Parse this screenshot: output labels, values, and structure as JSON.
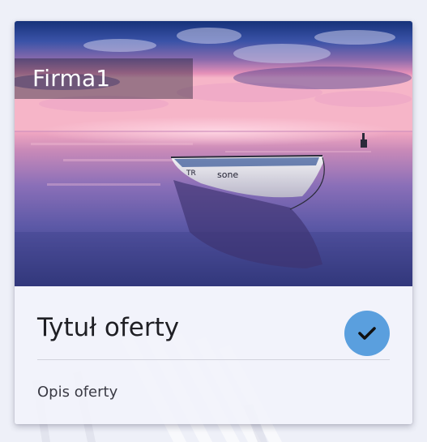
{
  "card": {
    "company_name": "Firma1",
    "title": "Tytuł oferty",
    "description": "Opis oferty",
    "image_icon": "boat-lake-sunset-photo",
    "select_icon": "check-icon"
  },
  "colors": {
    "page_background": "#eef0f8",
    "card_background": "#f2f3fb",
    "select_button": "#5a9fde",
    "check_mark": "#111111",
    "title_text": "#1f1f24",
    "description_text": "#3a3a44"
  }
}
